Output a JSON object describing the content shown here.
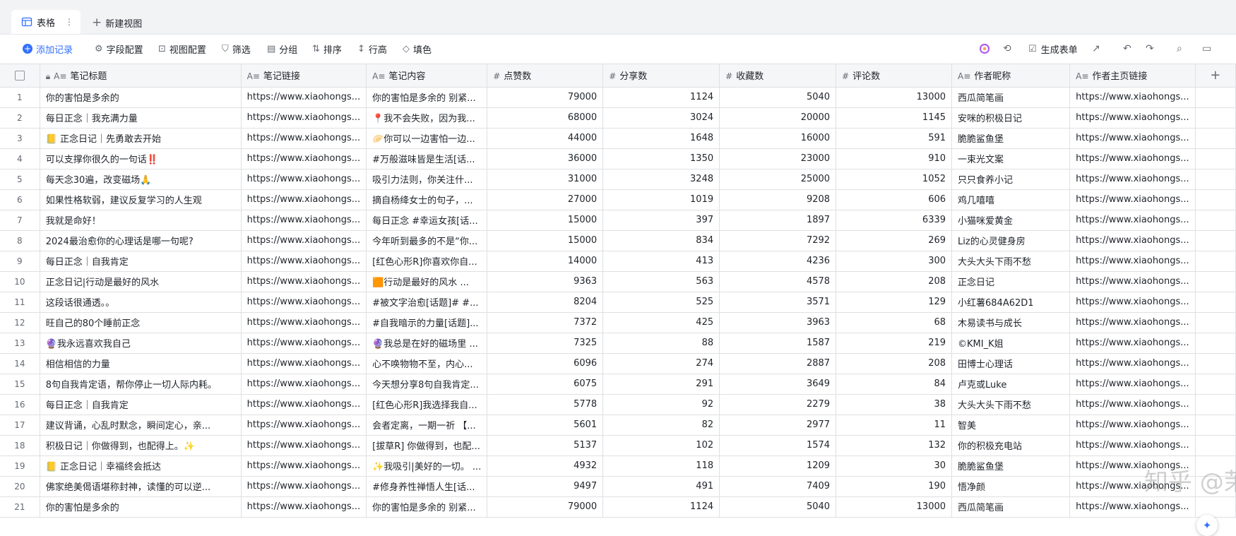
{
  "tabs": {
    "active_label": "表格",
    "new_view_label": "新建视图",
    "menu_glyph": "⋮"
  },
  "toolbar": {
    "add_record": "添加记录",
    "field_config": "字段配置",
    "view_config": "视图配置",
    "filter": "筛选",
    "group": "分组",
    "sort": "排序",
    "row_height": "行高",
    "fill_color": "填色",
    "generate_form": "生成表单"
  },
  "columns": [
    "笔记标题",
    "笔记链接",
    "笔记内容",
    "点赞数",
    "分享数",
    "收藏数",
    "评论数",
    "作者昵称",
    "作者主页链接"
  ],
  "rows": [
    [
      "1",
      "你的害怕是多余的",
      "https://www.xiaohongs...",
      "你的害怕是多余的 别紧...",
      "79000",
      "1124",
      "5040",
      "13000",
      "西瓜简笔画",
      "https://www.xiaohongs..."
    ],
    [
      "2",
      "每日正念｜我充满力量",
      "https://www.xiaohongs...",
      "📍我不会失败，因为我...",
      "68000",
      "3024",
      "20000",
      "1145",
      "安咪的积极日记",
      "https://www.xiaohongs..."
    ],
    [
      "3",
      "📒 正念日记｜先勇敢去开始",
      "https://www.xiaohongs...",
      "🥟你可以一边害怕一边...",
      "44000",
      "1648",
      "16000",
      "591",
      "脆脆鲨鱼堡",
      "https://www.xiaohongs..."
    ],
    [
      "4",
      "可以支撑你很久的一句话‼️",
      "https://www.xiaohongs...",
      "#万般滋味皆是生活[话...",
      "36000",
      "1350",
      "23000",
      "910",
      "一束光文案",
      "https://www.xiaohongs..."
    ],
    [
      "5",
      "每天念30遍，改变磁场🙏",
      "https://www.xiaohongs...",
      "吸引力法则，你关注什...",
      "31000",
      "3248",
      "25000",
      "1052",
      "只只食养小记",
      "https://www.xiaohongs..."
    ],
    [
      "6",
      "如果性格软弱，建议反复学习的人生观",
      "https://www.xiaohongs...",
      "摘自杨绛女士的句子，...",
      "27000",
      "1019",
      "9208",
      "606",
      "鸡几嘻嘻",
      "https://www.xiaohongs..."
    ],
    [
      "7",
      "我就是命好！",
      "https://www.xiaohongs...",
      "每日正念 #幸运女孩[话...",
      "15000",
      "397",
      "1897",
      "6339",
      "小猫咪爱黄金",
      "https://www.xiaohongs..."
    ],
    [
      "8",
      "2024最治愈你的心理话是哪一句呢?",
      "https://www.xiaohongs...",
      "今年听到最多的不是“你...",
      "15000",
      "834",
      "7292",
      "269",
      "Liz的心灵健身房",
      "https://www.xiaohongs..."
    ],
    [
      "9",
      "每日正念｜自我肯定",
      "https://www.xiaohongs...",
      "[红色心形R]你喜欢你自...",
      "14000",
      "413",
      "4236",
      "300",
      "大头大头下雨不愁",
      "https://www.xiaohongs..."
    ],
    [
      "10",
      "正念日记|行动是最好的风水",
      "https://www.xiaohongs...",
      "🟧行动是最好的风水 ...",
      "9363",
      "563",
      "4578",
      "208",
      "正念日记",
      "https://www.xiaohongs..."
    ],
    [
      "11",
      "这段话很通透。。",
      "https://www.xiaohongs...",
      "#被文字治愈[话题]# #...",
      "8204",
      "525",
      "3571",
      "129",
      "小红薯684A62D1",
      "https://www.xiaohongs..."
    ],
    [
      "12",
      "旺自己的80个睡前正念",
      "https://www.xiaohongs...",
      "#自我暗示的力量[话题]...",
      "7372",
      "425",
      "3963",
      "68",
      "木易读书与成长",
      "https://www.xiaohongs..."
    ],
    [
      "13",
      "🔮我永远喜欢我自己",
      "https://www.xiaohongs...",
      "🔮我总是在好的磁场里 ...",
      "7325",
      "88",
      "1587",
      "219",
      "©KMI_K姐",
      "https://www.xiaohongs..."
    ],
    [
      "14",
      "相信相信的力量",
      "https://www.xiaohongs...",
      "心不唤物物不至，内心...",
      "6096",
      "274",
      "2887",
      "208",
      "田博士心理话",
      "https://www.xiaohongs..."
    ],
    [
      "15",
      "8句自我肯定语，帮你停止一切人际内耗。",
      "https://www.xiaohongs...",
      "今天想分享8句自我肯定...",
      "6075",
      "291",
      "3649",
      "84",
      "卢克或Luke",
      "https://www.xiaohongs..."
    ],
    [
      "16",
      "每日正念｜自我肯定",
      "https://www.xiaohongs...",
      "[红色心形R]我选择我自...",
      "5778",
      "92",
      "2279",
      "38",
      "大头大头下雨不愁",
      "https://www.xiaohongs..."
    ],
    [
      "17",
      "建议背诵，心乱时默念，瞬间定心，亲...",
      "https://www.xiaohongs...",
      "会者定离，一期一祈 【...",
      "5601",
      "82",
      "2977",
      "11",
      "智美",
      "https://www.xiaohongs..."
    ],
    [
      "18",
      "积极日记｜你做得到，也配得上。✨",
      "https://www.xiaohongs...",
      "[拔草R] 你做得到，也配...",
      "5137",
      "102",
      "1574",
      "132",
      "你的积极充电站",
      "https://www.xiaohongs..."
    ],
    [
      "19",
      "📒 正念日记｜幸福终会抵达",
      "https://www.xiaohongs...",
      "✨我吸引|美好的一切。 ...",
      "4932",
      "118",
      "1209",
      "30",
      "脆脆鲨鱼堡",
      "https://www.xiaohongs..."
    ],
    [
      "20",
      "佛家绝美偈语堪称封神，读懂的可以逆...",
      "https://www.xiaohongs...",
      "#修身养性禅悟人生[话...",
      "9497",
      "491",
      "7409",
      "190",
      "悟净颜",
      "https://www.xiaohongs..."
    ],
    [
      "21",
      "你的害怕是多余的",
      "https://www.xiaohongs...",
      "你的害怕是多余的 别紧...",
      "79000",
      "1124",
      "5040",
      "13000",
      "西瓜简笔画",
      "https://www.xiaohongs..."
    ]
  ],
  "watermark": "知乎 @茉茉AI成长",
  "colors": {
    "accent": "#3370ff",
    "border": "#dee0e3",
    "header_bg": "#f5f6f7"
  }
}
